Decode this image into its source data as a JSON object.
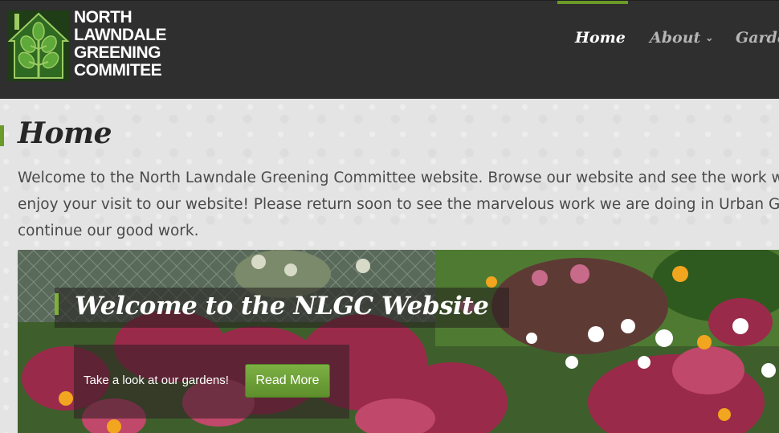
{
  "logo": {
    "name_lines": [
      "NORTH",
      "LAWNDALE",
      "GREENING",
      "COMMITEE"
    ],
    "icon": "tree-house-icon"
  },
  "nav": {
    "items": [
      {
        "label": "Home",
        "active": true
      },
      {
        "label": "About",
        "has_dropdown": true
      },
      {
        "label": "Garde"
      }
    ],
    "chevron": "⌄"
  },
  "page": {
    "title": "Home",
    "welcome_lines": [
      "Welcome to the North Lawndale Greening Committee website. Browse our website and see the work we ar",
      "enjoy your visit to our website! Please return soon to see the marvelous work we are doing in Urban Garde",
      "continue our good work."
    ]
  },
  "slider": {
    "title": "Welcome to the NLGC Website",
    "caption": "Take a look at our gardens!",
    "button_label": "Read More"
  },
  "colors": {
    "header_bg": "#2f2f2f",
    "accent_green": "#6a9a28",
    "button_green": "#6fa03a"
  }
}
